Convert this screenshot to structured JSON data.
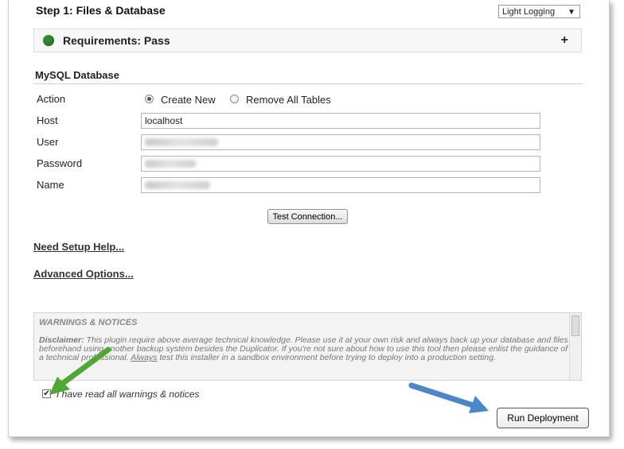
{
  "header": {
    "step_title": "Step 1: Files & Database",
    "logging_select": {
      "value": "Light Logging",
      "arrow": "▼"
    }
  },
  "requirements": {
    "label": "Requirements: Pass",
    "status_color": "#2e8b2e",
    "expand_symbol": "+"
  },
  "mysql": {
    "section_title": "MySQL Database",
    "action": {
      "label": "Action",
      "options": [
        {
          "label": "Create New",
          "checked": true
        },
        {
          "label": "Remove All Tables",
          "checked": false
        }
      ]
    },
    "host": {
      "label": "Host",
      "value": "localhost"
    },
    "user": {
      "label": "User"
    },
    "password": {
      "label": "Password"
    },
    "name": {
      "label": "Name"
    },
    "test_button": "Test Connection..."
  },
  "links": {
    "setup_help": "Need Setup Help...",
    "advanced": "Advanced Options..."
  },
  "warnings": {
    "title": "WARNINGS & NOTICES",
    "disclaimer_label": "Disclaimer:",
    "text_part1": " This plugin require above average technical knowledge. Please use it at your own risk and always back up your database and files beforehand using another backup system besides the Duplicator. If you're not sure about how to use this tool then please enlist the guidance of a technical professional. ",
    "always": "Always",
    "text_part2": " test this installer in a sandbox environment before trying to deploy into a production setting."
  },
  "agree": {
    "label": "I have read all warnings & notices",
    "checked": true,
    "check_mark": "✔"
  },
  "run_button": "Run Deployment",
  "colors": {
    "green_arrow": "#4fa832",
    "blue_arrow": "#4a86cc"
  }
}
